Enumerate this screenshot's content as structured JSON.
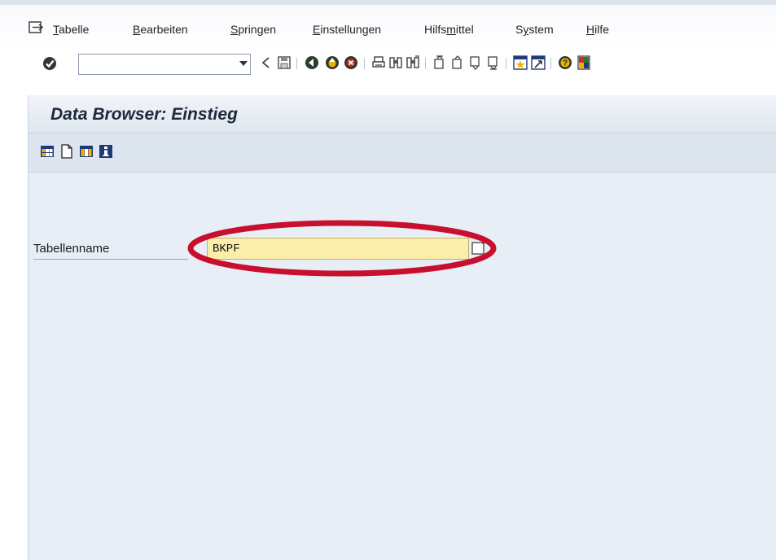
{
  "menu": {
    "items": [
      {
        "prefix": "",
        "accel": "T",
        "rest": "abelle"
      },
      {
        "prefix": "",
        "accel": "B",
        "rest": "earbeiten"
      },
      {
        "prefix": "",
        "accel": "S",
        "rest": "pringen"
      },
      {
        "prefix": "",
        "accel": "E",
        "rest": "instellungen"
      },
      {
        "prefix": "Hilfs",
        "accel": "m",
        "rest": "ittel"
      },
      {
        "prefix": "S",
        "accel": "y",
        "rest": "stem"
      },
      {
        "prefix": "",
        "accel": "H",
        "rest": "ilfe"
      }
    ]
  },
  "toolbar": {
    "command_value": "",
    "icons": [
      "enter-icon",
      "back-arrow-icon",
      "save-icon",
      "back-icon",
      "exit-icon",
      "cancel-icon",
      "print-icon",
      "find-icon",
      "find-next-icon",
      "first-page-icon",
      "previous-page-icon",
      "next-page-icon",
      "last-page-icon",
      "create-session-icon",
      "shortcut-icon",
      "help-icon",
      "layout-icon"
    ]
  },
  "page": {
    "title": "Data Browser: Einstieg"
  },
  "app_toolbar": {
    "icons": [
      "table-contents-icon",
      "new-entries-icon",
      "table-view-icon",
      "info-icon"
    ]
  },
  "form": {
    "table_name_label": "Tabellenname",
    "table_name_value": "BKPF"
  },
  "colors": {
    "accent_red": "#c8102e",
    "input_yellow": "#fbeeaa",
    "main_bg": "#e8eef6"
  }
}
